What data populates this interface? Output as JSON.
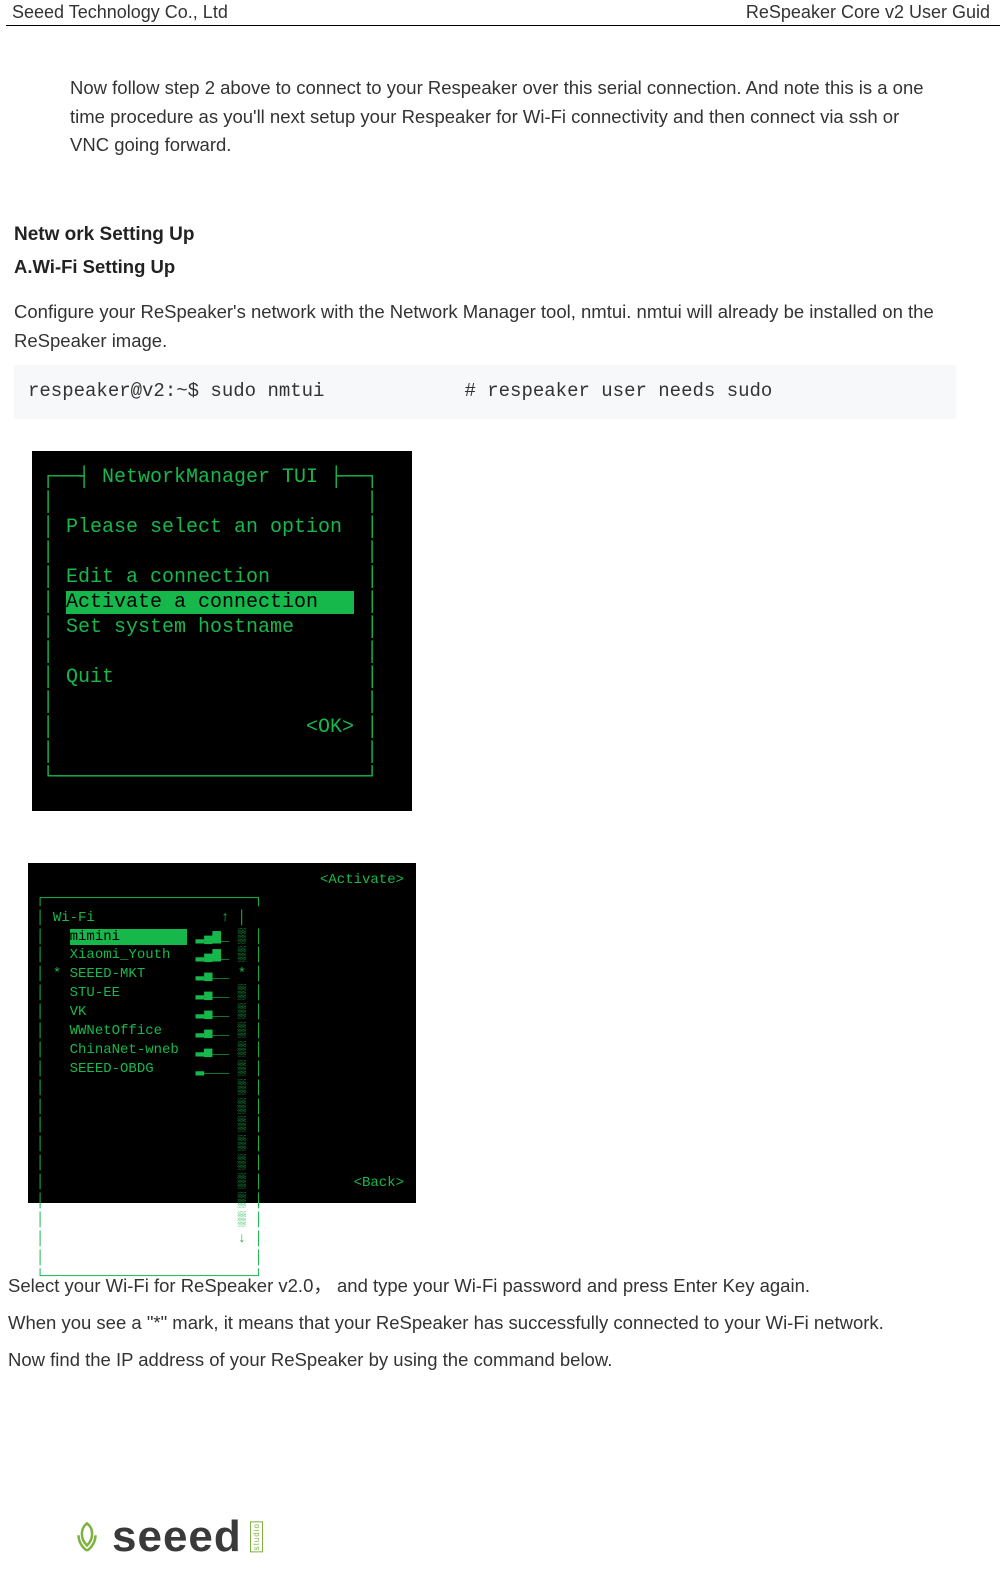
{
  "header": {
    "left": "Seeed Technology Co., Ltd",
    "right": "ReSpeaker Core v2 User Guid"
  },
  "intro": "Now follow step 2 above to connect to your Respeaker over this serial connection. And note this is a one time procedure as you'll next setup your Respeaker for Wi-Fi connectivity and then connect via ssh or VNC going forward.",
  "sections": {
    "network_title": "Netw ork Setting Up",
    "wifi_title": "A.Wi-Fi Setting Up",
    "config_para": "Configure your ReSpeaker's network with the Network Manager tool, nmtui. nmtui will already be installed on the ReSpeaker image."
  },
  "cmd": {
    "prompt": "respeaker@v2:~$ sudo nmtui",
    "comment": "# respeaker user needs sudo"
  },
  "tui1": {
    "title": "NetworkManager TUI",
    "prompt": "Please select an option",
    "options": {
      "edit": "Edit a connection",
      "activate": "Activate a connection",
      "hostname": "Set system hostname",
      "quit": "Quit"
    },
    "ok": "<OK>"
  },
  "tui2": {
    "header": "Wi-Fi",
    "networks": [
      {
        "marker": " ",
        "name": "mimini",
        "selected": true
      },
      {
        "marker": " ",
        "name": "Xiaomi_Youth",
        "selected": false
      },
      {
        "marker": "*",
        "name": "SEEED-MKT",
        "selected": false
      },
      {
        "marker": " ",
        "name": "STU-EE",
        "selected": false
      },
      {
        "marker": " ",
        "name": "VK",
        "selected": false
      },
      {
        "marker": " ",
        "name": "WWNetOffice",
        "selected": false
      },
      {
        "marker": " ",
        "name": "ChinaNet-wneb",
        "selected": false
      },
      {
        "marker": " ",
        "name": "SEEED-OBDG",
        "selected": false
      }
    ],
    "activate": "<Activate>",
    "back": "<Back>"
  },
  "followup": {
    "line1": "Select your Wi-Fi for ReSpeaker v2.0，  and type your  Wi-Fi password and press Enter Key again.",
    "line2": "When you see a \"*\" mark, it means that your ReSpeaker has successfully connected to your Wi-Fi network.",
    "line3": "Now find the IP address of your ReSpeaker by using the command below."
  },
  "logo": {
    "word": "seeed",
    "side": "studio"
  }
}
